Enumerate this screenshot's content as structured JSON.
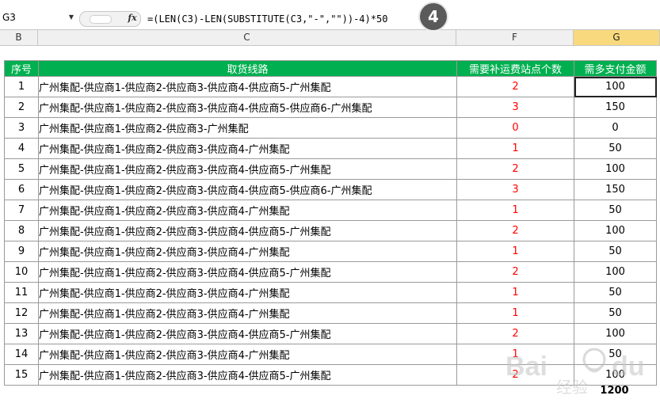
{
  "formula_bar": {
    "name_box": "G3",
    "fx_label": "fx",
    "formula": "=(LEN(C3)-LEN(SUBSTITUTE(C3,\"-\",\"\"))-4)*50",
    "step_badge": "4"
  },
  "column_headers": [
    "B",
    "C",
    "F",
    "G"
  ],
  "selected_column": "G",
  "table": {
    "headers": [
      "序号",
      "取货线路",
      "需要补运费站点个数",
      "需多支付金额"
    ],
    "rows": [
      {
        "no": "1",
        "route": "广州集配-供应商1-供应商2-供应商3-供应商4-供应商5-广州集配",
        "count": "2",
        "amount": "100"
      },
      {
        "no": "2",
        "route": "广州集配-供应商1-供应商2-供应商3-供应商4-供应商5-供应商6-广州集配",
        "count": "3",
        "amount": "150"
      },
      {
        "no": "3",
        "route": "广州集配-供应商1-供应商2-供应商3-广州集配",
        "count": "0",
        "amount": "0"
      },
      {
        "no": "4",
        "route": "广州集配-供应商1-供应商2-供应商3-供应商4-广州集配",
        "count": "1",
        "amount": "50"
      },
      {
        "no": "5",
        "route": "广州集配-供应商1-供应商2-供应商3-供应商4-供应商5-广州集配",
        "count": "2",
        "amount": "100"
      },
      {
        "no": "6",
        "route": "广州集配-供应商1-供应商2-供应商3-供应商4-供应商5-供应商6-广州集配",
        "count": "3",
        "amount": "150"
      },
      {
        "no": "7",
        "route": "广州集配-供应商1-供应商2-供应商3-供应商4-广州集配",
        "count": "1",
        "amount": "50"
      },
      {
        "no": "8",
        "route": "广州集配-供应商1-供应商2-供应商3-供应商4-供应商5-广州集配",
        "count": "2",
        "amount": "100"
      },
      {
        "no": "9",
        "route": "广州集配-供应商1-供应商2-供应商3-供应商4-广州集配",
        "count": "1",
        "amount": "50"
      },
      {
        "no": "10",
        "route": "广州集配-供应商1-供应商2-供应商3-供应商4-供应商5-广州集配",
        "count": "2",
        "amount": "100"
      },
      {
        "no": "11",
        "route": "广州集配-供应商1-供应商2-供应商3-供应商4-广州集配",
        "count": "1",
        "amount": "50"
      },
      {
        "no": "12",
        "route": "广州集配-供应商1-供应商2-供应商3-供应商4-广州集配",
        "count": "1",
        "amount": "50"
      },
      {
        "no": "13",
        "route": "广州集配-供应商1-供应商2-供应商3-供应商4-供应商5-广州集配",
        "count": "2",
        "amount": "100"
      },
      {
        "no": "14",
        "route": "广州集配-供应商1-供应商2-供应商3-供应商4-广州集配",
        "count": "1",
        "amount": "50"
      },
      {
        "no": "15",
        "route": "广州集配-供应商1-供应商2-供应商3-供应商4-供应商5-广州集配",
        "count": "2",
        "amount": "100"
      }
    ],
    "total": "1200"
  },
  "colors": {
    "header_green": "#00b050",
    "count_red": "#ff0000",
    "selected_col": "#f9d97d"
  },
  "watermark_text": "Bai du 经验"
}
